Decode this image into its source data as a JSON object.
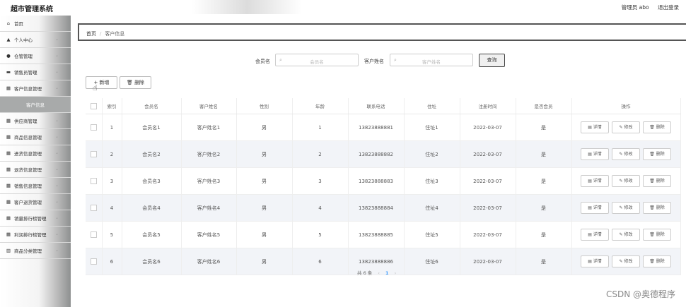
{
  "app": {
    "title": "超市管理系统",
    "admin": "管理员 abo",
    "logout": "退出登录"
  },
  "sidebar": {
    "items": [
      {
        "icon": "⌂",
        "icon_name": "home-icon",
        "label": "首页",
        "chevron": false
      },
      {
        "icon": "▲",
        "icon_name": "user-icon",
        "label": "个人中心",
        "chevron": true
      },
      {
        "icon": "●",
        "icon_name": "warehouse-icon",
        "label": "仓管管理",
        "chevron": true
      },
      {
        "icon": "▬",
        "icon_name": "salesperson-icon",
        "label": "销售员管理",
        "chevron": true
      },
      {
        "icon": "▦",
        "icon_name": "grid-icon",
        "label": "客户信息管理",
        "chevron": true
      },
      {
        "icon": "",
        "icon_name": "",
        "label": "客户信息",
        "chevron": false,
        "active": true
      },
      {
        "icon": "▦",
        "icon_name": "grid-icon",
        "label": "供应商管理",
        "chevron": true
      },
      {
        "icon": "▦",
        "icon_name": "grid-icon",
        "label": "商品信息管理",
        "chevron": true
      },
      {
        "icon": "▦",
        "icon_name": "document-icon",
        "label": "进货信息管理",
        "chevron": true
      },
      {
        "icon": "▦",
        "icon_name": "document-icon",
        "label": "退货信息管理",
        "chevron": true
      },
      {
        "icon": "▦",
        "icon_name": "chart-icon",
        "label": "销售信息管理",
        "chevron": true
      },
      {
        "icon": "▦",
        "icon_name": "grid-icon",
        "label": "客户退货管理",
        "chevron": true
      },
      {
        "icon": "▦",
        "icon_name": "grid-icon",
        "label": "销量排行榜管理",
        "chevron": true
      },
      {
        "icon": "▦",
        "icon_name": "grid-icon",
        "label": "利润排行榜管理",
        "chevron": true
      },
      {
        "icon": "▥",
        "icon_name": "bar-chart-icon",
        "label": "商品分类管理",
        "chevron": true
      }
    ]
  },
  "breadcrumb": {
    "home": "首页",
    "current": "客户信息"
  },
  "search": {
    "member_label": "会员名",
    "member_placeholder": "会员名",
    "name_label": "客户姓名",
    "name_placeholder": "客户姓名",
    "button": "查询"
  },
  "actions": {
    "add": "+ 新增",
    "delete": "删除"
  },
  "table": {
    "headers": [
      "索引",
      "会员名",
      "客户姓名",
      "性别",
      "年龄",
      "联系电话",
      "住址",
      "注册时间",
      "是否会员",
      "操作"
    ],
    "rows": [
      [
        "1",
        "会员名1",
        "客户姓名1",
        "男",
        "1",
        "13823888881",
        "住址1",
        "2022-03-07",
        "是"
      ],
      [
        "2",
        "会员名2",
        "客户姓名2",
        "男",
        "2",
        "13823888882",
        "住址2",
        "2022-03-07",
        "是"
      ],
      [
        "3",
        "会员名3",
        "客户姓名3",
        "男",
        "3",
        "13823888883",
        "住址3",
        "2022-03-07",
        "是"
      ],
      [
        "4",
        "会员名4",
        "客户姓名4",
        "男",
        "4",
        "13823888884",
        "住址4",
        "2022-03-07",
        "是"
      ],
      [
        "5",
        "会员名5",
        "客户姓名5",
        "男",
        "5",
        "13823888885",
        "住址5",
        "2022-03-07",
        "是"
      ],
      [
        "6",
        "会员名6",
        "客户姓名6",
        "男",
        "6",
        "13823888886",
        "住址6",
        "2022-03-07",
        "是"
      ]
    ],
    "op_detail": "详情",
    "op_edit": "修改",
    "op_delete": "删除"
  },
  "pager": {
    "total": "共 6 条",
    "prev": "‹",
    "page": "1",
    "next": "›"
  },
  "watermark": "CSDN @奥德程序",
  "colors": {
    "accent": "#409eff",
    "sidebar_active": "#a8aaaa"
  }
}
